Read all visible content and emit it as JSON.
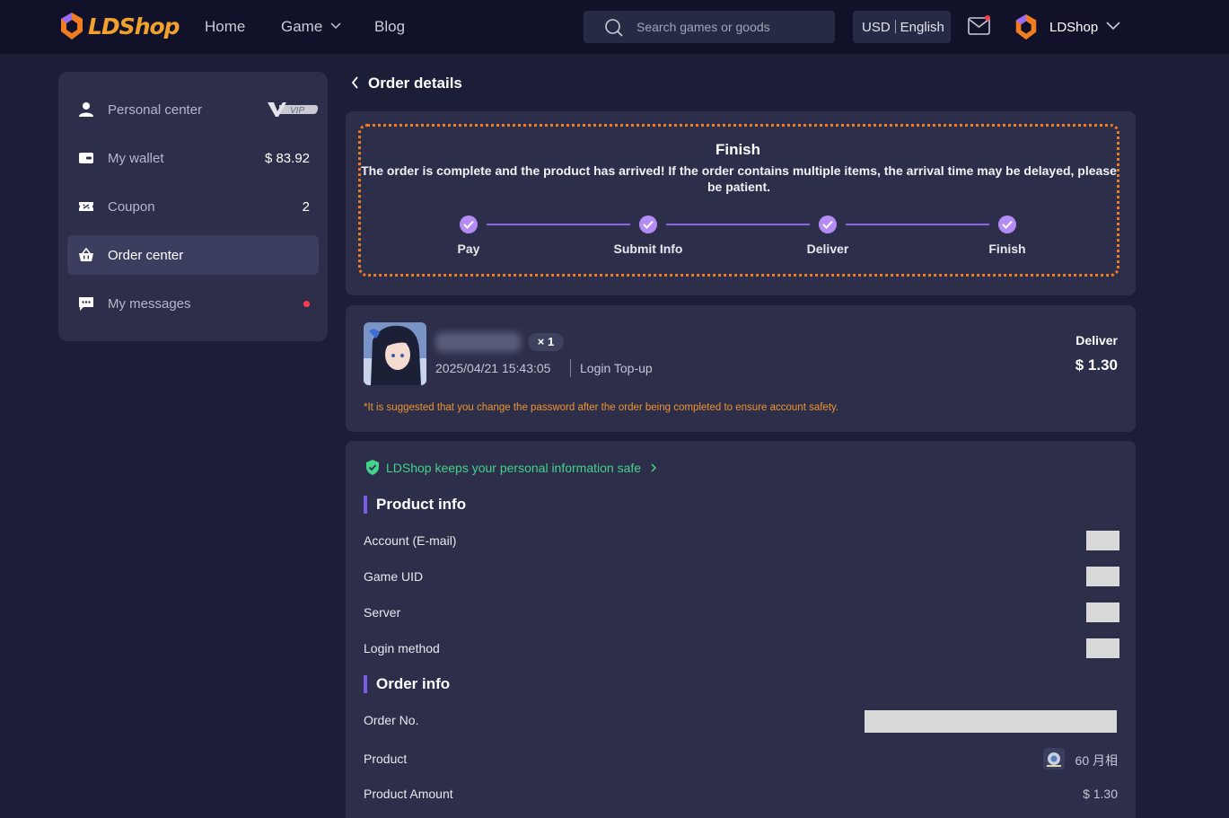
{
  "header": {
    "logo_text": "LDShop",
    "nav": {
      "home": "Home",
      "game": "Game",
      "blog": "Blog"
    },
    "search_placeholder": "Search games or goods",
    "currency": "USD",
    "language": "English",
    "user_name": "LDShop"
  },
  "sidebar": {
    "items": [
      {
        "label": "Personal center",
        "badge": "VIP"
      },
      {
        "label": "My wallet",
        "value": "$ 83.92"
      },
      {
        "label": "Coupon",
        "value": "2"
      },
      {
        "label": "Order center"
      },
      {
        "label": "My messages"
      }
    ]
  },
  "page": {
    "title": "Order details"
  },
  "status": {
    "title": "Finish",
    "description": "The order is complete and the product has arrived! If the order contains multiple items, the arrival time may be delayed, please be patient.",
    "steps": [
      "Pay",
      "Submit Info",
      "Deliver",
      "Finish"
    ]
  },
  "order": {
    "quantity": "× 1",
    "date": "2025/04/21 15:43:05",
    "type": "Login Top-up",
    "status": "Deliver",
    "price": "$ 1.30",
    "warning": "*It is suggested that you change the password after the order being completed to ensure account safety."
  },
  "details": {
    "safe_text": "LDShop keeps your personal information safe",
    "product_info_title": "Product info",
    "product_rows": [
      "Account (E-mail)",
      "Game UID",
      "Server",
      "Login method"
    ],
    "order_info_title": "Order info",
    "order_no_label": "Order No.",
    "product_label": "Product",
    "product_value": "60 月相",
    "amount_label": "Product Amount",
    "amount_value": "$ 1.30"
  },
  "colors": {
    "accent": "#7b5be3",
    "warning": "#f0942e",
    "safe": "#46d28a",
    "brand": "#f0a12e"
  }
}
